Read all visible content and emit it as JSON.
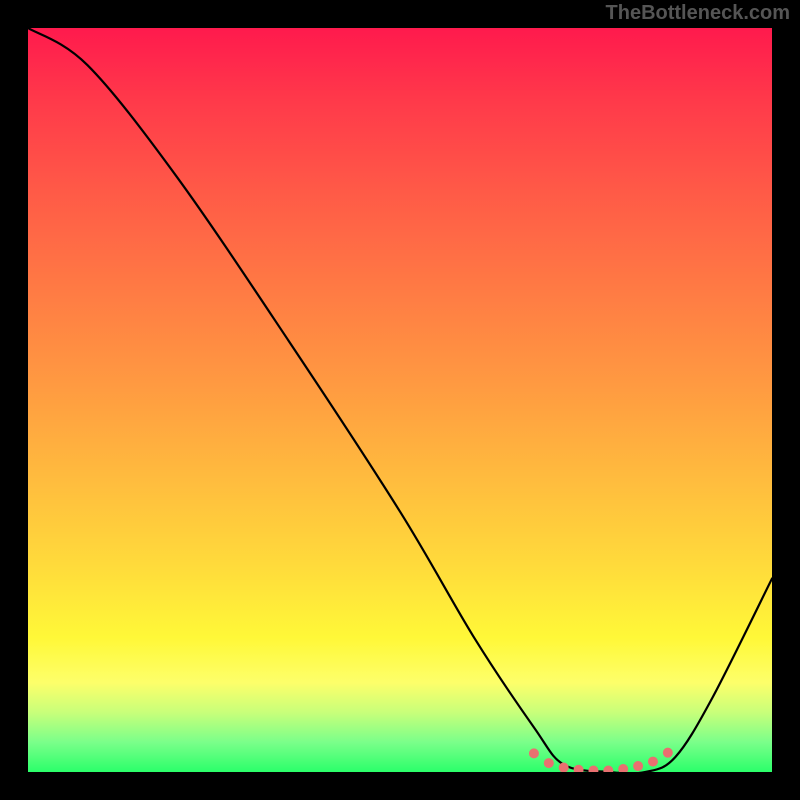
{
  "watermark": "TheBottleneck.com",
  "chart_data": {
    "type": "line",
    "title": "",
    "xlabel": "",
    "ylabel": "",
    "xlim": [
      0,
      100
    ],
    "ylim": [
      0,
      100
    ],
    "background_gradient": {
      "top": "#ff1a4d",
      "bottom": "#2bff6a",
      "meaning": "red high to green low"
    },
    "series": [
      {
        "name": "bottleneck-curve",
        "x": [
          0,
          8,
          20,
          35,
          50,
          60,
          68,
          72,
          78,
          83,
          87,
          92,
          100
        ],
        "y": [
          100,
          95,
          80,
          58,
          35,
          18,
          6,
          1,
          0,
          0,
          2,
          10,
          26
        ]
      }
    ],
    "highlight_points": {
      "name": "optimal-range-dots",
      "x": [
        68,
        70,
        72,
        74,
        76,
        78,
        80,
        82,
        84,
        86
      ],
      "y": [
        2.5,
        1.2,
        0.6,
        0.3,
        0.2,
        0.2,
        0.4,
        0.8,
        1.4,
        2.6
      ]
    },
    "grid": false,
    "legend": false
  }
}
